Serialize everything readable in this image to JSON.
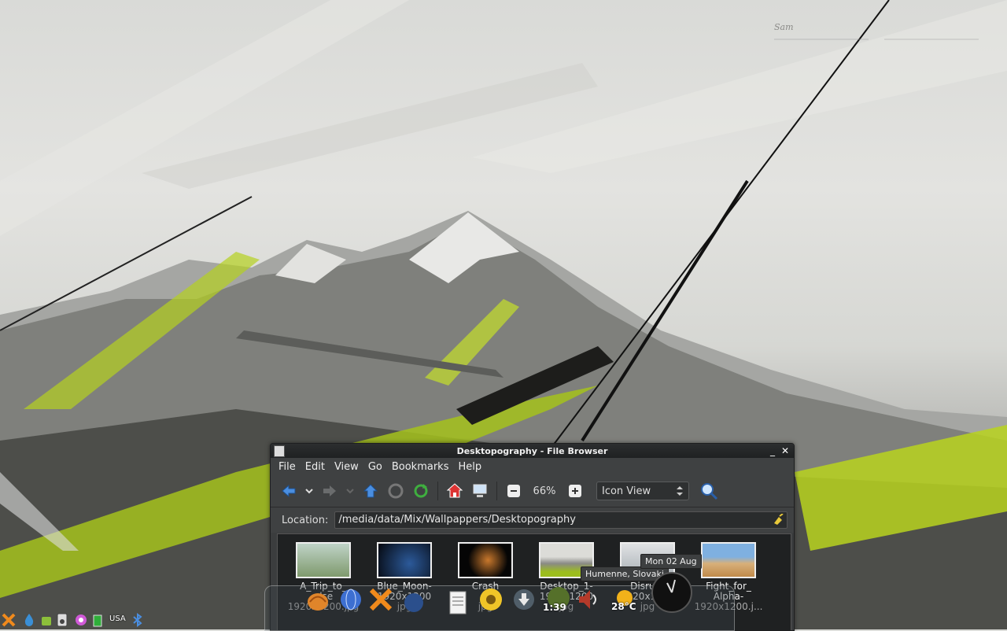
{
  "window": {
    "title": "Desktopography - File Browser",
    "minimize_label": "_",
    "close_label": "✕"
  },
  "menu": [
    "File",
    "Edit",
    "View",
    "Go",
    "Bookmarks",
    "Help"
  ],
  "toolbar": {
    "zoom_level": "66%",
    "view_mode": "Icon View"
  },
  "location": {
    "label": "Location:",
    "path": "/media/data/Mix/Wallpappers/Desktopography"
  },
  "files": [
    {
      "line1": "A_Trip_to_",
      "line2": "else",
      "line3": "1920x1200.jpg"
    },
    {
      "line1": "Blue_Moon-",
      "line2": "1920x1200",
      "line3": "jpg"
    },
    {
      "line1": "Crash",
      "line2": "x",
      "line3": "jpg"
    },
    {
      "line1": "Desktop_1-",
      "line2": "1920x1200",
      "line3": "jpg"
    },
    {
      "line1": "Disrupt",
      "line2": "1920x1200",
      "line3": "jpg"
    },
    {
      "line1": "Fight_for_",
      "line2": "Alpha-",
      "line3": "1920x1200.j..."
    }
  ],
  "dock": {
    "clock_time": "1:39",
    "weather_temp": "28°C",
    "tooltip_location": "Humenne, Slovaki",
    "tooltip_date": "Mon 02 Aug"
  },
  "tray": {
    "keyboard_layout": "USA"
  },
  "wallpaper": {
    "signature": "Sam"
  }
}
